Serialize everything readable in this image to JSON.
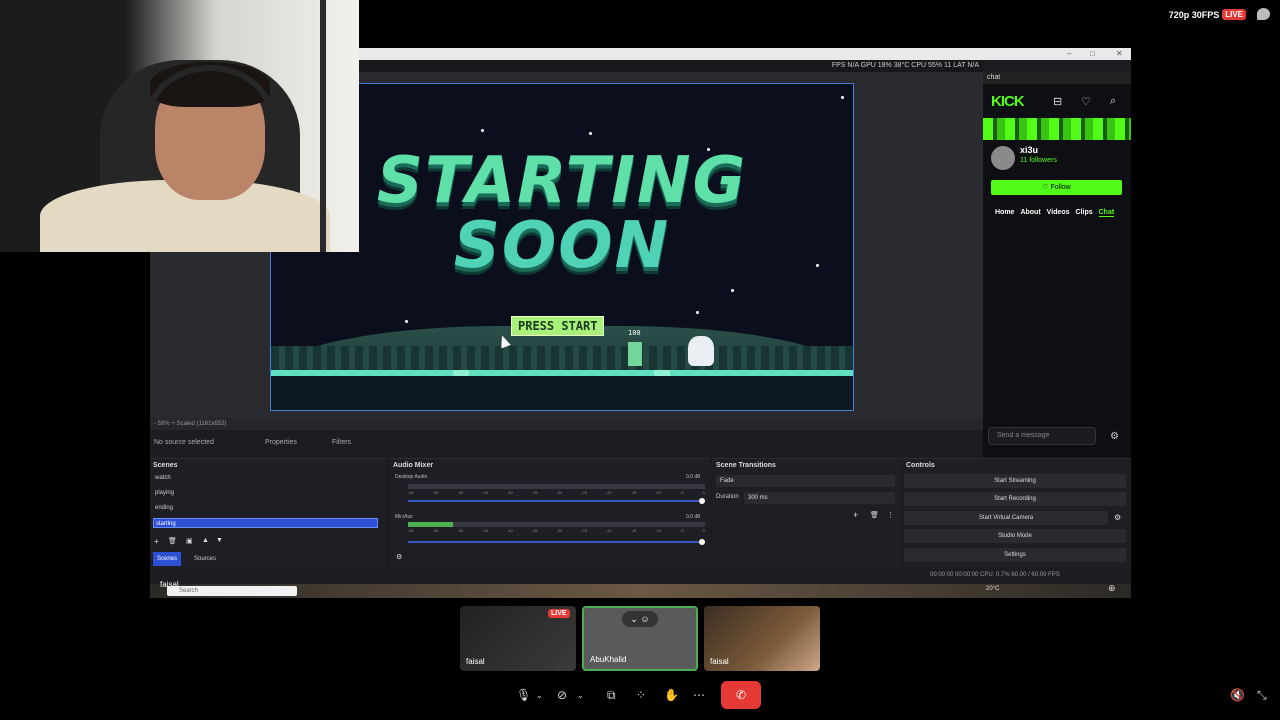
{
  "top_overlay": {
    "quality": "720p 30FPS",
    "live": "LIVE"
  },
  "obs": {
    "stats": "FPS N/A GPU 18% 38°C CPU 55% 11 LAT N/A",
    "preview_status": "- 59% + Scaled (1161x652)",
    "no_source": "No source selected",
    "properties_label": "Properties",
    "filters_label": "Filters",
    "stream_title_1": "STARTING",
    "stream_title_2": "SOON",
    "press_start": "PRESS START",
    "score": "100",
    "scenes": {
      "title": "Scenes",
      "items": [
        "watch",
        "playing",
        "ending",
        "starting"
      ],
      "selected": "starting",
      "tabs": [
        "Scenes",
        "Sources"
      ]
    },
    "audio_mixer": {
      "title": "Audio Mixer",
      "channels": [
        {
          "name": "Desktop Audio",
          "db": "0.0 dB",
          "level": 0
        },
        {
          "name": "Mic/Aux",
          "db": "0.0 dB",
          "level": 0.15
        }
      ],
      "ticks": [
        "-60",
        "-55",
        "-50",
        "-45",
        "-40",
        "-35",
        "-30",
        "-25",
        "-20",
        "-15",
        "-10",
        "-5",
        "0"
      ]
    },
    "scene_transitions": {
      "title": "Scene Transitions",
      "transition": "Fade",
      "duration_label": "Duration",
      "duration_value": "300 ms"
    },
    "controls": {
      "title": "Controls",
      "buttons": [
        "Start Streaming",
        "Start Recording",
        "Start Virtual Camera",
        "Studio Mode",
        "Settings"
      ]
    },
    "bottom_status": "00:00:00   00:00:00   CPU: 0.7%   60.00 / 60.00 FPS",
    "taskbar_search": "Search",
    "taskbar_weather": "20°C"
  },
  "kick": {
    "header": "chat",
    "logo": "KICK",
    "channel_name": "xi3u",
    "followers": "11 followers",
    "follow_label": "♡ Follow",
    "nav": [
      "Home",
      "About",
      "Videos",
      "Clips",
      "Chat"
    ],
    "active_nav": "Chat",
    "chat_placeholder": "Send a message"
  },
  "meeting": {
    "tiles": [
      {
        "name": "faisal",
        "live": "LIVE"
      },
      {
        "name": "AbuKhalid"
      },
      {
        "name": "faisal"
      }
    ],
    "presenter_label": "faisal"
  },
  "colors": {
    "kick_green": "#53fc18",
    "obs_selected": "#2d4fd1",
    "hangup_red": "#e53935"
  }
}
